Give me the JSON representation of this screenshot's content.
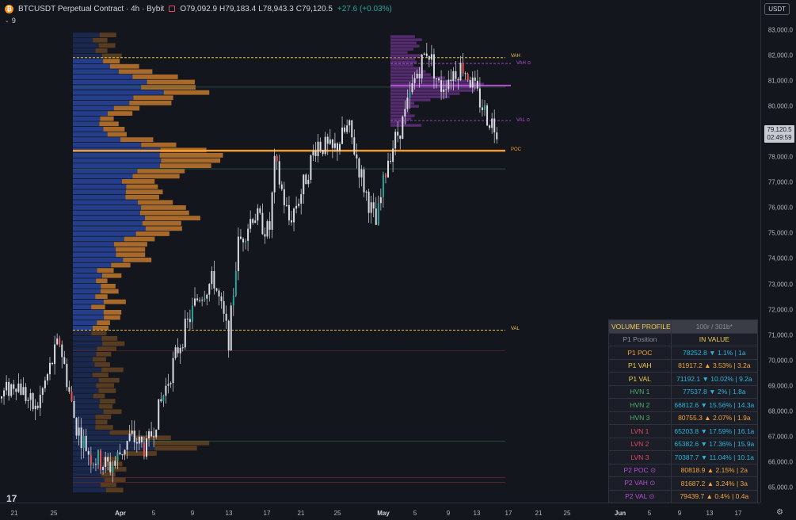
{
  "header": {
    "symbol": "BTCUSDT Perpetual Contract · 4h · Bybit",
    "ohlc": [
      {
        "k": "O",
        "v": "79,092.9"
      },
      {
        "k": "H",
        "v": "79,183.4"
      },
      {
        "k": "L",
        "v": "78,943.3"
      },
      {
        "k": "C",
        "v": "79,120.5"
      }
    ],
    "change": "+27.6 (+0.03%)",
    "currency": "USDT",
    "indicator_count": "9"
  },
  "price_axis": [
    "83,000.0",
    "82,000.0",
    "81,000.0",
    "80,000.0",
    "79,000.0",
    "78,000.0",
    "77,000.0",
    "76,000.0",
    "75,000.0",
    "74,000.0",
    "73,000.0",
    "72,000.0",
    "71,000.0",
    "70,000.0",
    "69,000.0",
    "68,000.0",
    "67,000.0",
    "66,000.0",
    "65,000.0"
  ],
  "last_price": {
    "price": "79,120.5",
    "countdown": "02:49:59"
  },
  "time_axis": [
    {
      "t": "21",
      "bold": false
    },
    {
      "t": "25",
      "bold": false
    },
    {
      "t": "Apr",
      "bold": true
    },
    {
      "t": "5",
      "bold": false
    },
    {
      "t": "9",
      "bold": false
    },
    {
      "t": "13",
      "bold": false
    },
    {
      "t": "17",
      "bold": false
    },
    {
      "t": "21",
      "bold": false
    },
    {
      "t": "25",
      "bold": false
    },
    {
      "t": "May",
      "bold": true
    },
    {
      "t": "5",
      "bold": false
    },
    {
      "t": "9",
      "bold": false
    },
    {
      "t": "13",
      "bold": false
    },
    {
      "t": "17",
      "bold": false
    },
    {
      "t": "21",
      "bold": false
    },
    {
      "t": "25",
      "bold": false
    },
    {
      "t": "Jun",
      "bold": true
    },
    {
      "t": "5",
      "bold": false
    },
    {
      "t": "9",
      "bold": false
    },
    {
      "t": "13",
      "bold": false
    },
    {
      "t": "17",
      "bold": false
    }
  ],
  "chart_labels": {
    "vah": "VAH",
    "val": "VAL",
    "poc": "POC",
    "p2_vah": "VAH ⊙",
    "p2_val": "VAL ⊙"
  },
  "table": {
    "title": "VOLUME PROFILE",
    "subtitle": "100r / 301b*",
    "col1": "P1 Position",
    "col2": "IN VALUE",
    "rows": [
      {
        "label": "P1 POC",
        "value": "78252.8",
        "arrow": "▼",
        "pct": "1.1%",
        "age": "1a",
        "label_color": "#f2a33a",
        "value_color": "#2bb3d9"
      },
      {
        "label": "P1 VAH",
        "value": "81917.2",
        "arrow": "▲",
        "pct": "3.53%",
        "age": "3.2a",
        "label_color": "#f0c94a",
        "value_color": "#f2a33a"
      },
      {
        "label": "P1 VAL",
        "value": "71192.1",
        "arrow": "▼",
        "pct": "10.02%",
        "age": "9.2a",
        "label_color": "#f0c94a",
        "value_color": "#2bb3d9"
      },
      {
        "label": "HVN 1",
        "value": "77537.8",
        "arrow": "▼",
        "pct": "2%",
        "age": "1.8a",
        "label_color": "#4caf6e",
        "value_color": "#2bb3d9"
      },
      {
        "label": "HVN 2",
        "value": "66812.6",
        "arrow": "▼",
        "pct": "15.56%",
        "age": "14.3a",
        "label_color": "#4caf6e",
        "value_color": "#2bb3d9"
      },
      {
        "label": "HVN 3",
        "value": "80755.3",
        "arrow": "▲",
        "pct": "2.07%",
        "age": "1.9a",
        "label_color": "#4caf6e",
        "value_color": "#f2a33a"
      },
      {
        "label": "LVN 1",
        "value": "65203.8",
        "arrow": "▼",
        "pct": "17.59%",
        "age": "16.1a",
        "label_color": "#e0475b",
        "value_color": "#2bb3d9"
      },
      {
        "label": "LVN 2",
        "value": "65382.6",
        "arrow": "▼",
        "pct": "17.36%",
        "age": "15.9a",
        "label_color": "#e0475b",
        "value_color": "#2bb3d9"
      },
      {
        "label": "LVN 3",
        "value": "70387.7",
        "arrow": "▼",
        "pct": "11.04%",
        "age": "10.1a",
        "label_color": "#e0475b",
        "value_color": "#2bb3d9"
      },
      {
        "label": "P2 POC ⊙",
        "value": "80818.9",
        "arrow": "▲",
        "pct": "2.15%",
        "age": "2a",
        "label_color": "#b44fd6",
        "value_color": "#f2a33a"
      },
      {
        "label": "P2 VAH ⊙",
        "value": "81687.2",
        "arrow": "▲",
        "pct": "3.24%",
        "age": "3a",
        "label_color": "#b44fd6",
        "value_color": "#f2a33a"
      },
      {
        "label": "P2 VAL ⊙",
        "value": "79439.7",
        "arrow": "▲",
        "pct": "0.4%",
        "age": "0.4a",
        "label_color": "#b44fd6",
        "value_color": "#f2a33a"
      }
    ]
  },
  "colors": {
    "up": "#26a69a",
    "down": "#ef5350",
    "candle": "#d9dce3",
    "profile_blue": "#243e8c",
    "profile_orange": "#a86a2a",
    "poc_line": "#f29a2e",
    "va_line": "#e8c33a",
    "p2": "#8b3fb3"
  }
}
